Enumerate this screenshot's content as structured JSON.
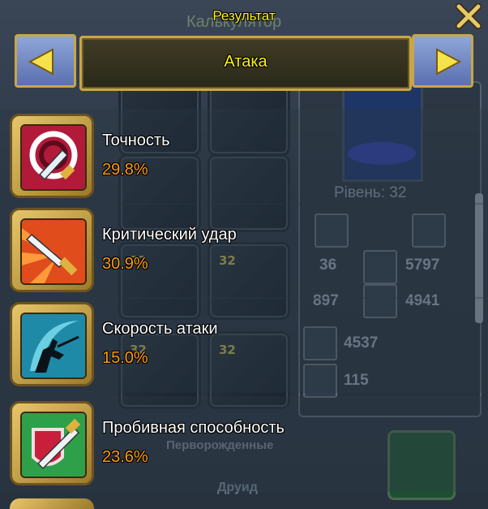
{
  "window": {
    "title": "Результат",
    "background_title": "Калькулятор",
    "close_label": "close"
  },
  "nav": {
    "title": "Атака",
    "prev_icon": "arrow-left-icon",
    "next_icon": "arrow-right-icon"
  },
  "stats": [
    {
      "name": "Точность",
      "value": "29.8%",
      "icon": "accuracy-icon"
    },
    {
      "name": "Критический удар",
      "value": "30.9%",
      "icon": "critical-strike-icon"
    },
    {
      "name": "Скорость атаки",
      "value": "15.0%",
      "icon": "attack-speed-icon"
    },
    {
      "name": "Пробивная способность",
      "value": "23.6%",
      "icon": "penetration-icon"
    }
  ],
  "background": {
    "level": "Рівень: 32",
    "slot_levels": [
      "32",
      "32",
      "32",
      "32"
    ],
    "stats": [
      "36",
      "5797",
      "897",
      "4941",
      "4537",
      "115"
    ],
    "race": "Перворожденные",
    "class": "Друид"
  },
  "colors": {
    "title_yellow": "#fff21a",
    "value_orange": "#ff9c10",
    "frame_gold": "#c9a54a",
    "nav_blue": "#6f86c4"
  }
}
